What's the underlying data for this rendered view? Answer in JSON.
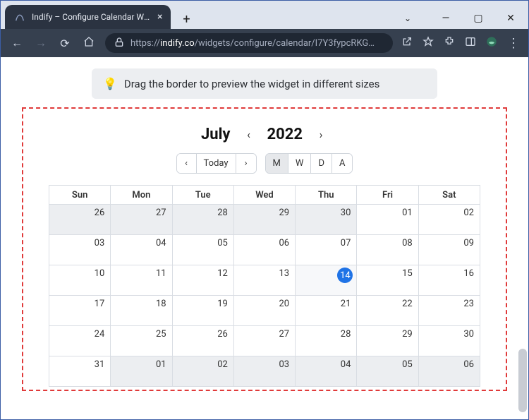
{
  "browser": {
    "tab_title": "Indify – Configure Calendar Widg",
    "url_domain": "indify.co",
    "url_rest": "/widgets/configure/calendar/I7Y3fypcRKG…",
    "url_prefix": "https://"
  },
  "hint": {
    "text": "Drag the border to preview the widget in different sizes"
  },
  "calendar": {
    "month": "July",
    "year": "2022",
    "today_label": "Today",
    "view_buttons": {
      "m": "M",
      "w": "W",
      "d": "D",
      "a": "A"
    },
    "day_headers": [
      "Sun",
      "Mon",
      "Tue",
      "Wed",
      "Thu",
      "Fri",
      "Sat"
    ],
    "rows": [
      {
        "cells": [
          {
            "n": "26",
            "dim": true
          },
          {
            "n": "27",
            "dim": true
          },
          {
            "n": "28",
            "dim": true
          },
          {
            "n": "29",
            "dim": true
          },
          {
            "n": "30",
            "dim": true
          },
          {
            "n": "01"
          },
          {
            "n": "02"
          }
        ]
      },
      {
        "cells": [
          {
            "n": "03"
          },
          {
            "n": "04"
          },
          {
            "n": "05"
          },
          {
            "n": "06"
          },
          {
            "n": "07"
          },
          {
            "n": "08"
          },
          {
            "n": "09"
          }
        ]
      },
      {
        "cells": [
          {
            "n": "10"
          },
          {
            "n": "11"
          },
          {
            "n": "12"
          },
          {
            "n": "13"
          },
          {
            "n": "14",
            "today": true
          },
          {
            "n": "15"
          },
          {
            "n": "16"
          }
        ]
      },
      {
        "cells": [
          {
            "n": "17"
          },
          {
            "n": "18"
          },
          {
            "n": "19"
          },
          {
            "n": "20"
          },
          {
            "n": "21"
          },
          {
            "n": "22"
          },
          {
            "n": "23"
          }
        ]
      },
      {
        "cells": [
          {
            "n": "24"
          },
          {
            "n": "25"
          },
          {
            "n": "26"
          },
          {
            "n": "27"
          },
          {
            "n": "28"
          },
          {
            "n": "29"
          },
          {
            "n": "30"
          }
        ]
      },
      {
        "cells": [
          {
            "n": "31"
          },
          {
            "n": "01",
            "dim": true
          },
          {
            "n": "02",
            "dim": true
          },
          {
            "n": "03",
            "dim": true
          },
          {
            "n": "04",
            "dim": true
          },
          {
            "n": "05",
            "dim": true
          },
          {
            "n": "06",
            "dim": true
          }
        ]
      }
    ]
  }
}
